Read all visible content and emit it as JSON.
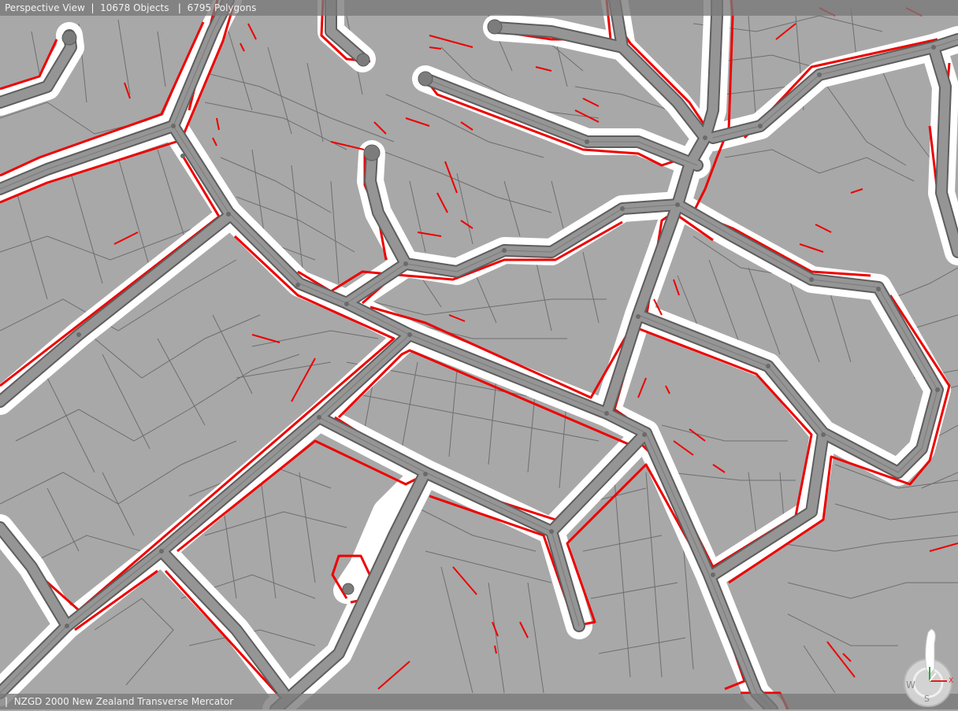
{
  "status_bar": {
    "view_name": "Perspective View",
    "objects": "10678 Objects",
    "polygons": "6795 Polygons",
    "separator": "|"
  },
  "footer": {
    "separator": "|",
    "projection": "NZGD 2000 New Zealand Transverse Mercator"
  },
  "compass": {
    "icon": "compass-axis-gizmo-icon",
    "labels": {
      "w": "W",
      "s": "S",
      "x": "X"
    },
    "colors": {
      "x_axis": "#e02020",
      "y_axis": "#20b030",
      "z_axis": "#ffffff"
    }
  },
  "scene": {
    "background": "#a8a8a8",
    "parcel_line": "#6e6e6e",
    "road_fill": "#8e8e8e",
    "road_edge": "#5a5a5a",
    "road_verge": "#ffffff",
    "highlight_line": "#ee0000"
  }
}
